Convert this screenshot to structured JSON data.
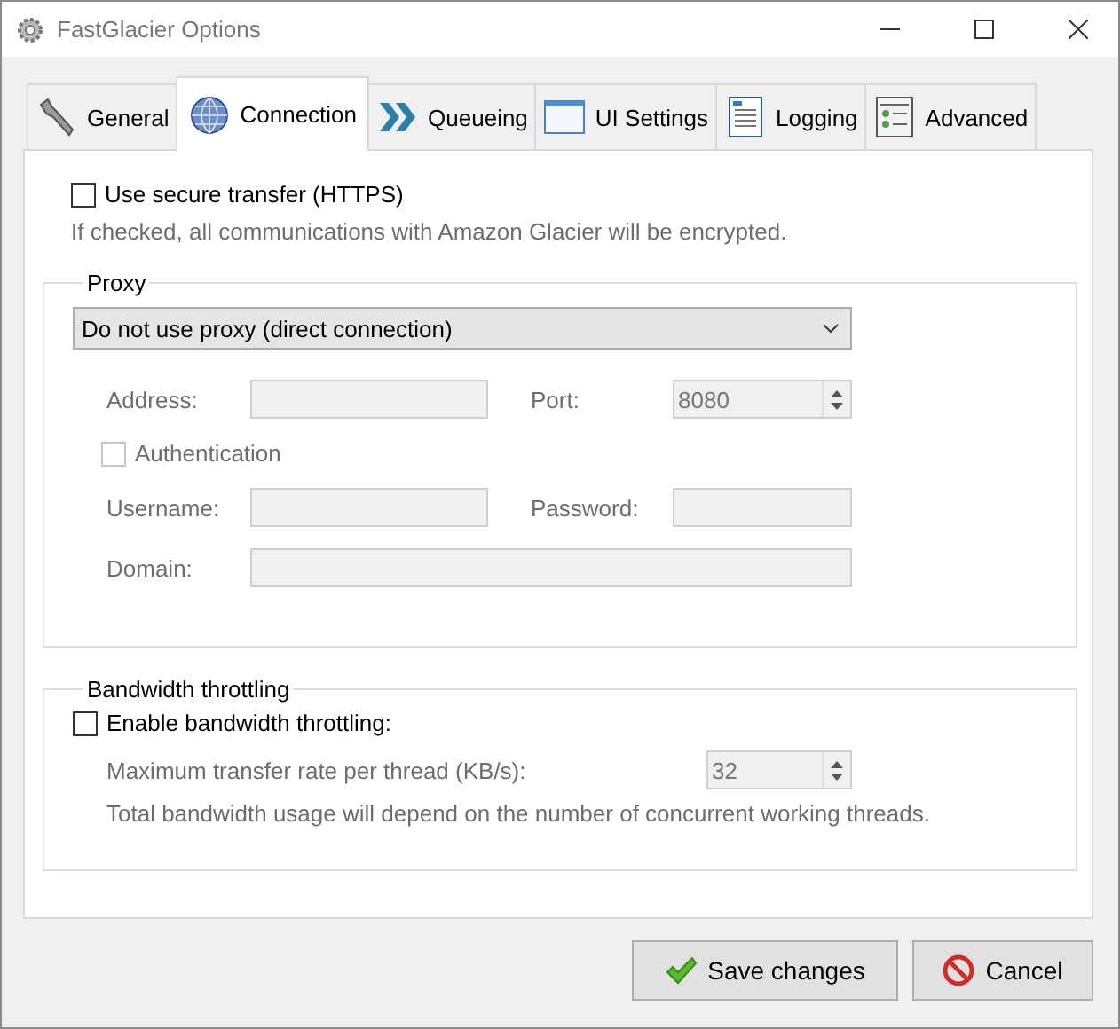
{
  "window": {
    "title": "FastGlacier Options"
  },
  "tabs": [
    {
      "label": "General",
      "selected": false
    },
    {
      "label": "Connection",
      "selected": true
    },
    {
      "label": "Queueing",
      "selected": false
    },
    {
      "label": "UI Settings",
      "selected": false
    },
    {
      "label": "Logging",
      "selected": false
    },
    {
      "label": "Advanced",
      "selected": false
    }
  ],
  "secure_transfer": {
    "label": "Use secure transfer (HTTPS)",
    "checked": false,
    "note": "If checked, all communications with Amazon Glacier will be encrypted."
  },
  "proxy": {
    "title": "Proxy",
    "mode": {
      "value": "Do not use proxy (direct connection)"
    },
    "address": {
      "label": "Address:",
      "disabled": true
    },
    "port": {
      "label": "Port:",
      "value": "8080",
      "disabled": true
    },
    "authentication": {
      "label": "Authentication",
      "checked": false,
      "disabled": true
    },
    "username": {
      "label": "Username:",
      "disabled": true
    },
    "password": {
      "label": "Password:",
      "disabled": true
    },
    "domain": {
      "label": "Domain:",
      "disabled": true
    }
  },
  "bandwidth": {
    "title": "Bandwidth throttling",
    "enable": {
      "label": "Enable bandwidth throttling:",
      "checked": false
    },
    "max_rate": {
      "label": "Maximum transfer rate per thread (KB/s):",
      "value": "32",
      "disabled": true
    },
    "note": "Total bandwidth usage will depend on the number of concurrent working threads."
  },
  "buttons": [
    {
      "label": "Save changes",
      "kind": "save"
    },
    {
      "label": "Cancel",
      "kind": "cancel"
    }
  ]
}
